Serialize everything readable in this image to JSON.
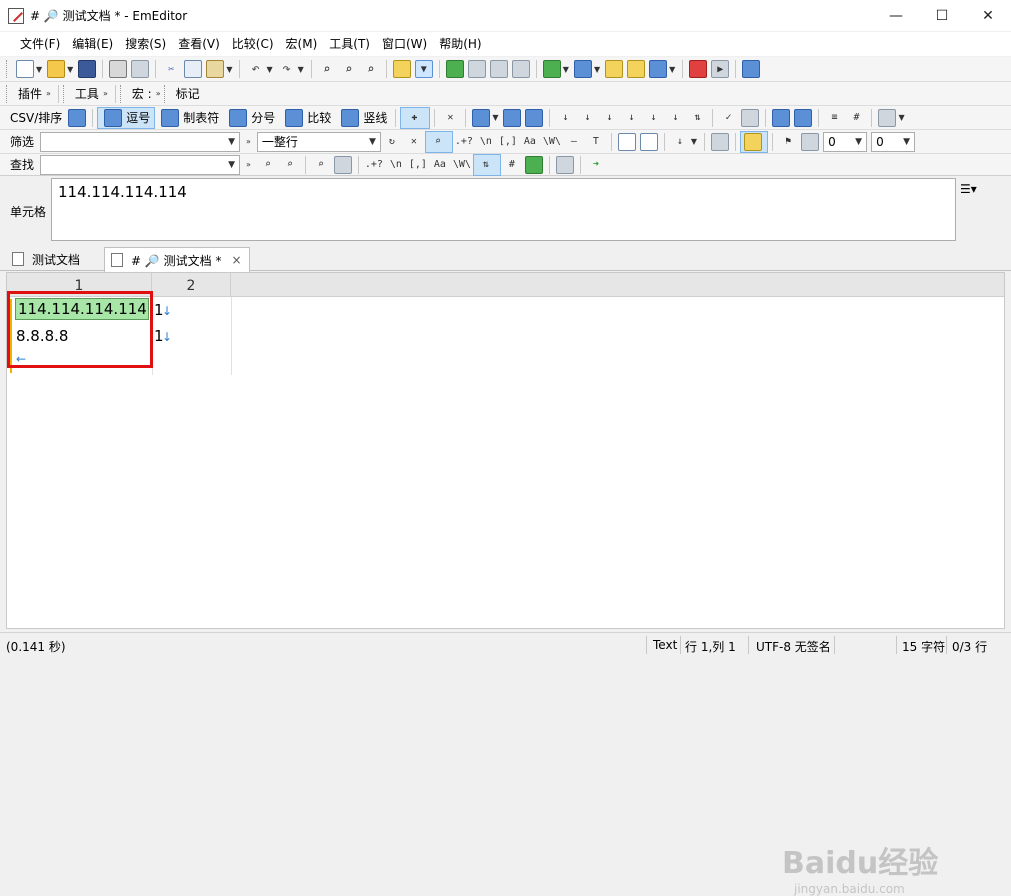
{
  "window": {
    "title": "# 🔎 测试文档 * - EmEditor",
    "minimize": "—",
    "maximize": "☐",
    "close": "✕"
  },
  "menu": [
    "文件(F)",
    "编辑(E)",
    "搜索(S)",
    "查看(V)",
    "比较(C)",
    "宏(M)",
    "工具(T)",
    "窗口(W)",
    "帮助(H)"
  ],
  "toolbar3": {
    "plugins": "插件",
    "tools": "工具",
    "macro": "宏 :",
    "bookmark": "标记",
    "more": "»"
  },
  "csv_toolbar": {
    "csv_sort": "CSV/排序",
    "comma": "逗号",
    "tab": "制表符",
    "semicolon": "分号",
    "compare": "比较",
    "vertical": "竖线"
  },
  "filter_bar": {
    "label": "筛选",
    "value": "",
    "scope": "一整行",
    "num1": "0",
    "num2": "0",
    "regex": ".+?",
    "newline": "\\n",
    "bracket": "[,]",
    "case": "Aa",
    "word": "\\W\\"
  },
  "find_bar": {
    "label": "查找",
    "value": "",
    "regex": ".+?",
    "newline": "\\n",
    "bracket": "[,]",
    "case": "Aa",
    "word": "\\W\\"
  },
  "cell_bar": {
    "label": "单元格",
    "value": "114.114.114.114"
  },
  "tabs": [
    {
      "label": "测试文档"
    },
    {
      "label": "# 🔎 测试文档 *",
      "close": "×"
    }
  ],
  "grid": {
    "columns": [
      "1",
      "2"
    ],
    "rows": [
      {
        "col1": "114.114.114.114",
        "col2": "1"
      },
      {
        "col1": "8.8.8.8",
        "col2": "1"
      }
    ],
    "eol_symbol": "↓",
    "eof_symbol": "←"
  },
  "status_bar": {
    "time": "(0.141 秒)",
    "mode": "Text",
    "position": "行 1,列 1",
    "encoding": "UTF-8 无签名",
    "chars": "15 字符",
    "lines": "0/3 行"
  },
  "watermark": {
    "brand": "Baidu经验",
    "url": "jingyan.baidu.com"
  },
  "colors": {
    "selected_cell": "#a8e6a8",
    "highlight_box": "#e01010",
    "eol": "#2a7fd4"
  }
}
